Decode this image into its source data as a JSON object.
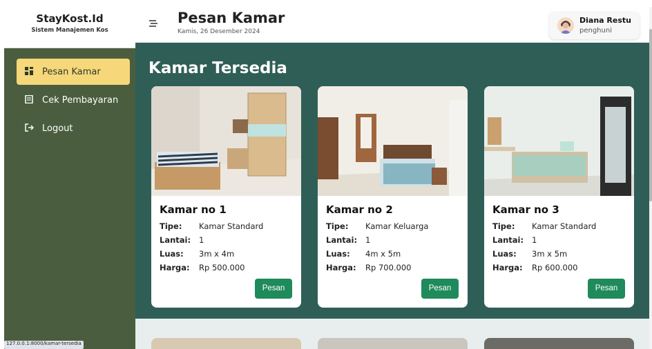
{
  "brand": {
    "title": "StayKost.Id",
    "subtitle": "Sistem Manajemen Kos"
  },
  "sidebar": {
    "items": [
      {
        "label": "Pesan Kamar",
        "icon": "dashboard-icon",
        "active": true
      },
      {
        "label": "Cek Pembayaran",
        "icon": "receipt-icon",
        "active": false
      },
      {
        "label": "Logout",
        "icon": "logout-icon",
        "active": false
      }
    ]
  },
  "header": {
    "title": "Pesan Kamar",
    "date": "Kamis, 26 Desember 2024"
  },
  "user": {
    "name": "Diana Restu",
    "role": "penghuni"
  },
  "main": {
    "section_title": "Kamar Tersedia",
    "labels": {
      "tipe": "Tipe:",
      "lantai": "Lantai:",
      "luas": "Luas:",
      "harga": "Harga:"
    },
    "rooms": [
      {
        "name": "Kamar no 1",
        "tipe": "Kamar Standard",
        "lantai": "1",
        "luas": "3m x 4m",
        "harga": "Rp 500.000",
        "button": "Pesan"
      },
      {
        "name": "Kamar no 2",
        "tipe": "Kamar Keluarga",
        "lantai": "1",
        "luas": "4m x 5m",
        "harga": "Rp 700.000",
        "button": "Pesan"
      },
      {
        "name": "Kamar no 3",
        "tipe": "Kamar Standard",
        "lantai": "1",
        "luas": "3m x 5m",
        "harga": "Rp 600.000",
        "button": "Pesan"
      }
    ]
  },
  "status_bar": {
    "url": "127.0.0.1:8000/kamar-tersedia"
  },
  "colors": {
    "sidebar": "#4a5e3f",
    "active_nav": "#f6d77a",
    "content": "#2f5e57",
    "button": "#1f8a5b"
  }
}
